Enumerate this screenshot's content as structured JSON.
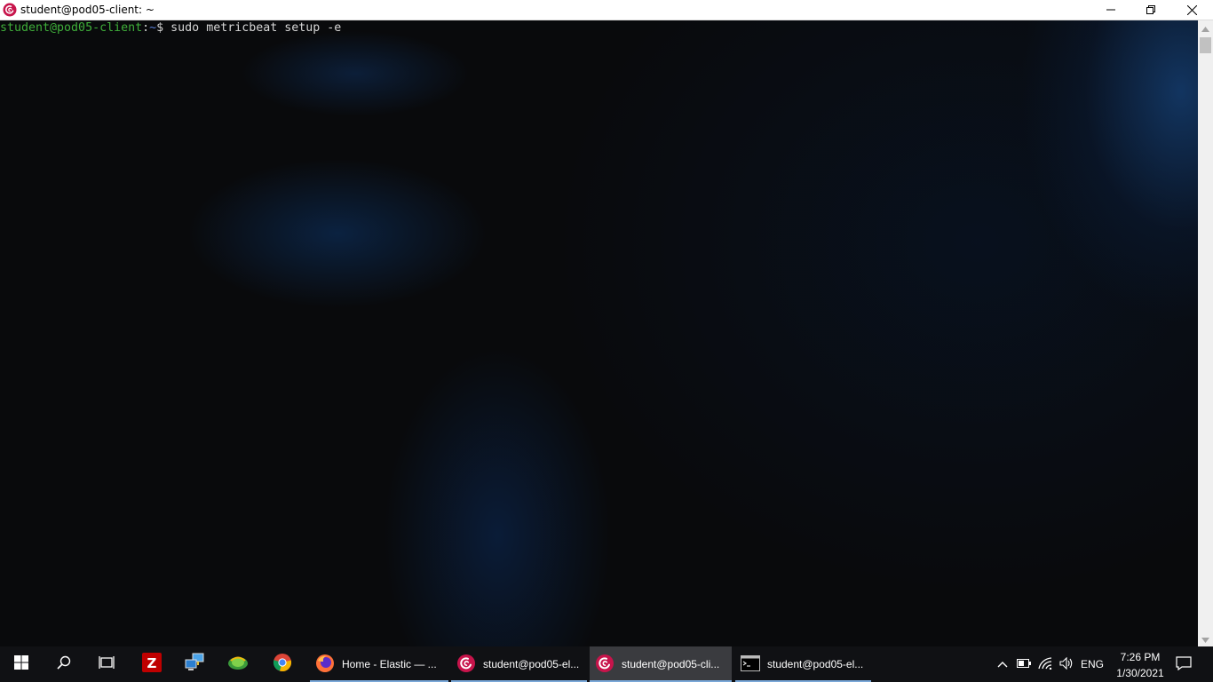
{
  "window": {
    "title": "student@pod05-client: ~",
    "app_icon": "debian-swirl-icon",
    "controls": [
      "minimize-icon",
      "restore-icon",
      "close-icon"
    ]
  },
  "terminal": {
    "prompt_user_host": "student@pod05-client",
    "prompt_colon": ":",
    "prompt_path": "~",
    "prompt_dollar": "$",
    "command": " sudo metricbeat setup -e"
  },
  "taskbar": {
    "pinned": [
      {
        "name": "start-button",
        "icon": "windows-logo-icon"
      },
      {
        "name": "search-button",
        "icon": "search-icon"
      },
      {
        "name": "task-view-button",
        "icon": "task-view-icon"
      },
      {
        "name": "filezilla-button",
        "icon": "filezilla-icon"
      },
      {
        "name": "network-app-button",
        "icon": "network-computer-icon"
      },
      {
        "name": "globe-app-button",
        "icon": "globe-icon"
      },
      {
        "name": "chrome-button",
        "icon": "chrome-icon"
      }
    ],
    "apps": [
      {
        "label": "Home - Elastic — ...",
        "icon": "firefox-icon"
      },
      {
        "label": "student@pod05-el...",
        "icon": "debian-swirl-icon"
      },
      {
        "label": "student@pod05-cli...",
        "icon": "debian-swirl-icon",
        "active": true
      },
      {
        "label": "student@pod05-el...",
        "icon": "console-icon"
      }
    ],
    "tray": {
      "language": "ENG",
      "time": "7:26 PM",
      "date": "1/30/2021",
      "icons": [
        "chevron-up-icon",
        "battery-icon",
        "wifi-icon",
        "speaker-icon",
        "notification-icon"
      ]
    }
  },
  "colors": {
    "prompt_user": "#3fae3a",
    "prompt_path": "#5a7fd8",
    "taskbar_bg": "#101114",
    "active_underline": "#7aa8d8"
  }
}
